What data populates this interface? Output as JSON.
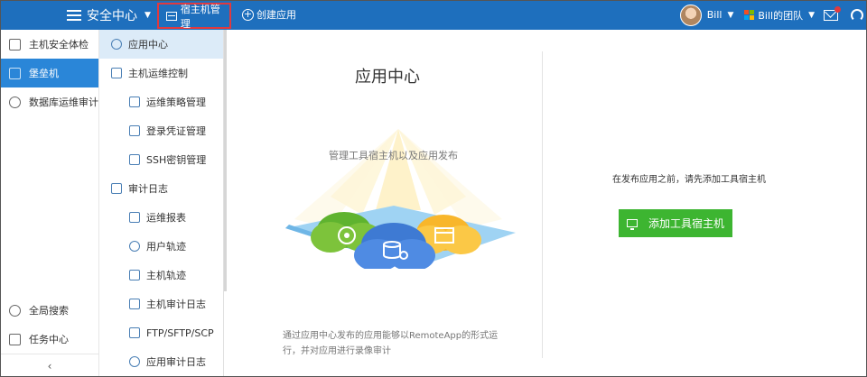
{
  "topbar": {
    "app_title": "安全中心",
    "host_manage": "宿主机管理",
    "create_app": "创建应用",
    "user": "Bill",
    "team": "Bill的团队"
  },
  "nav_primary": {
    "items": [
      {
        "label": "主机安全体检",
        "icon": "shield-check-icon"
      },
      {
        "label": "堡垒机",
        "icon": "bastion-icon",
        "active": true
      },
      {
        "label": "数据库运维审计",
        "icon": "database-icon"
      }
    ],
    "bottom": [
      {
        "label": "全局搜索",
        "icon": "search-icon"
      },
      {
        "label": "任务中心",
        "icon": "task-icon"
      }
    ]
  },
  "nav_secondary": {
    "items": [
      {
        "label": "应用中心",
        "level": 1,
        "active": true
      },
      {
        "label": "主机运维控制",
        "level": 1
      },
      {
        "label": "运维策略管理",
        "level": 2
      },
      {
        "label": "登录凭证管理",
        "level": 2
      },
      {
        "label": "SSH密钥管理",
        "level": 2
      },
      {
        "label": "审计日志",
        "level": 1
      },
      {
        "label": "运维报表",
        "level": 2
      },
      {
        "label": "用户轨迹",
        "level": 2
      },
      {
        "label": "主机轨迹",
        "level": 2
      },
      {
        "label": "主机审计日志",
        "level": 2
      },
      {
        "label": "FTP/SFTP/SCP",
        "level": 2
      },
      {
        "label": "应用审计日志",
        "level": 2
      }
    ]
  },
  "main": {
    "title": "应用中心",
    "subtitle": "管理工具宿主机以及应用发布",
    "description": "通过应用中心发布的应用能够以RemoteApp的形式运行，并对应用进行录像审计",
    "notice": "在发布应用之前，请先添加工具宿主机",
    "add_button": "添加工具宿主机"
  },
  "colors": {
    "topbar": "#1e6fbd",
    "active_nav": "#2a86d8",
    "button_green": "#3db531",
    "highlight_border": "#e0393e"
  }
}
